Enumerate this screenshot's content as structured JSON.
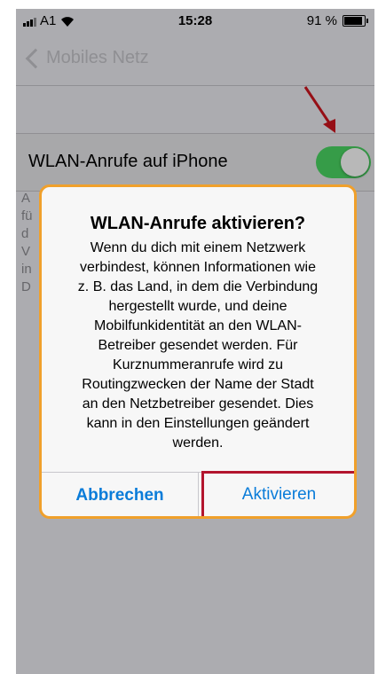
{
  "status_bar": {
    "carrier": "A1",
    "time": "15:28",
    "battery": "91 %"
  },
  "nav": {
    "back_label": "Mobiles Netz"
  },
  "setting": {
    "label": "WLAN-Anrufe auf iPhone",
    "toggle_on": true,
    "toggle_color": "#4cd964"
  },
  "footer_letters": [
    "A",
    "fü",
    "d",
    "V",
    "in",
    "D"
  ],
  "alert": {
    "title": "WLAN-Anrufe aktivieren?",
    "message_lines": [
      "Wenn du dich mit einem Netzwerk",
      "verbindest, können Informationen wie",
      "z. B. das Land, in dem die Verbindung",
      "hergestellt wurde, und deine",
      "Mobilfunkidentität an den WLAN-",
      "Betreiber gesendet werden. Für",
      "Kurznummeranrufe wird zu",
      "Routingzwecken der Name der Stadt",
      "an den Netzbetreiber gesendet. Dies",
      "kann in den Einstellungen geändert",
      "werden."
    ],
    "cancel_label": "Abbrechen",
    "activate_label": "Aktivieren"
  },
  "colors": {
    "accent": "#0a7cd9",
    "highlight_box": "#b3152e",
    "alert_border": "#f0a02b",
    "arrow": "#d0151f"
  }
}
